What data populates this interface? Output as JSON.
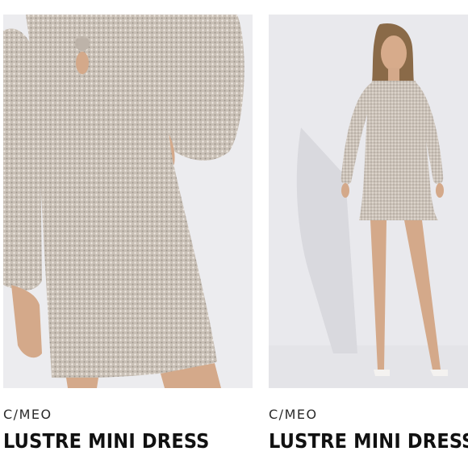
{
  "products": [
    {
      "brand": "C/MEO",
      "name": "LUSTRE MINI DRESS",
      "image_desc": "close-up-dress-photo"
    },
    {
      "brand": "C/MEO",
      "name": "LUSTRE MINI DRESS",
      "image_desc": "full-length-model-photo"
    }
  ],
  "colors": {
    "dress": "#c8beb4",
    "sequin": "#ece6df",
    "backdrop_left": "#ececef",
    "backdrop_right": "#e9e9ed",
    "skin": "#d4a98a"
  }
}
